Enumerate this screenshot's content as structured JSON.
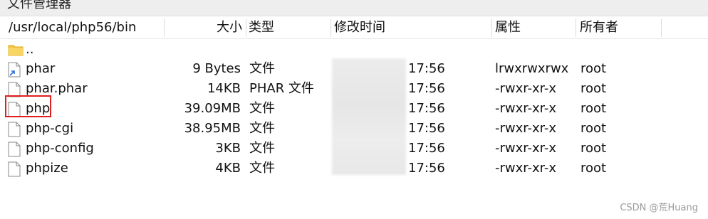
{
  "window": {
    "title": "文件管理器"
  },
  "header": {
    "path": "/usr/local/php56/bin",
    "columns": {
      "size": "大小",
      "type": "类型",
      "modified": "修改时间",
      "attributes": "属性",
      "owner": "所有者"
    }
  },
  "files": [
    {
      "icon": "folder-icon",
      "name": "..",
      "size": "",
      "type": "",
      "time": "",
      "perm": "",
      "owner": ""
    },
    {
      "icon": "shortcut-file-icon",
      "name": "phar",
      "size": "9 Bytes",
      "type": "文件",
      "time": "17:56",
      "perm": "lrwxrwxrwx",
      "owner": "root"
    },
    {
      "icon": "file-icon",
      "name": "phar.phar",
      "size": "14KB",
      "type": "PHAR 文件",
      "time": "17:56",
      "perm": "-rwxr-xr-x",
      "owner": "root"
    },
    {
      "icon": "file-icon",
      "name": "php",
      "size": "39.09MB",
      "type": "文件",
      "time": "17:56",
      "perm": "-rwxr-xr-x",
      "owner": "root"
    },
    {
      "icon": "file-icon",
      "name": "php-cgi",
      "size": "38.95MB",
      "type": "文件",
      "time": "17:56",
      "perm": "-rwxr-xr-x",
      "owner": "root"
    },
    {
      "icon": "file-icon",
      "name": "php-config",
      "size": "3KB",
      "type": "文件",
      "time": "17:56",
      "perm": "-rwxr-xr-x",
      "owner": "root"
    },
    {
      "icon": "file-icon",
      "name": "phpize",
      "size": "4KB",
      "type": "文件",
      "time": "17:56",
      "perm": "-rwxr-xr-x",
      "owner": "root"
    }
  ],
  "watermark": "CSDN @荒Huang",
  "colors": {
    "highlight": "#e02020",
    "folder": "#f4c542"
  }
}
